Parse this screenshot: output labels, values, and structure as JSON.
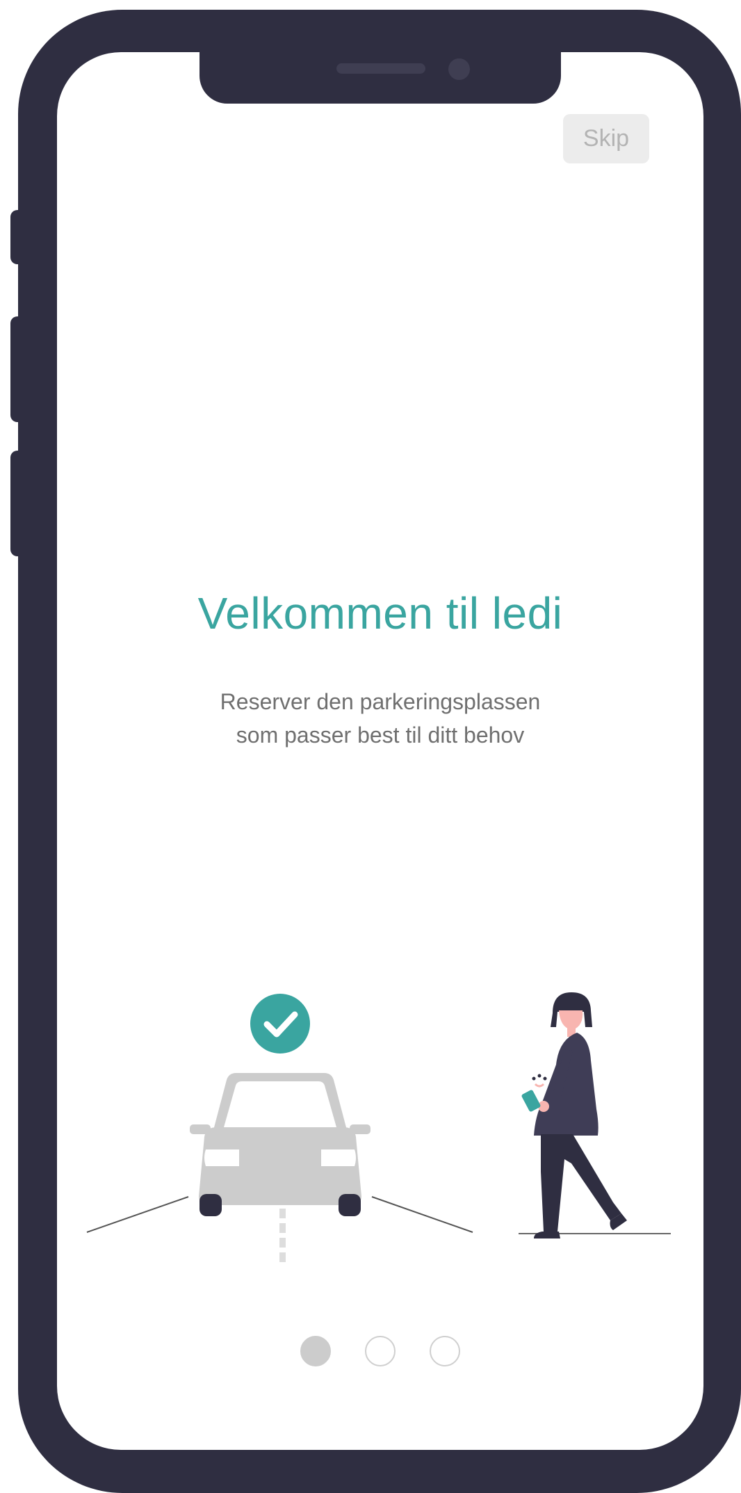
{
  "header": {
    "skip_label": "Skip"
  },
  "onboarding": {
    "title": "Velkommen til ledi",
    "subtitle_line1": "Reserver den parkeringsplassen",
    "subtitle_line2": "som passer best til ditt behov"
  },
  "pagination": {
    "total_pages": 3,
    "current_page": 1
  },
  "illustration": {
    "icons": [
      "car-icon",
      "check-badge-icon",
      "person-with-phone-icon"
    ]
  },
  "colors": {
    "accent": "#3aa5a0",
    "device_frame": "#2f2e41",
    "car": "#cccccc",
    "skip_bg": "#ececec",
    "skip_text": "#b3b3b3",
    "subtitle_text": "#6f6f6f",
    "dot_active": "#cccccc",
    "dot_inactive_border": "#cfcfcf"
  }
}
